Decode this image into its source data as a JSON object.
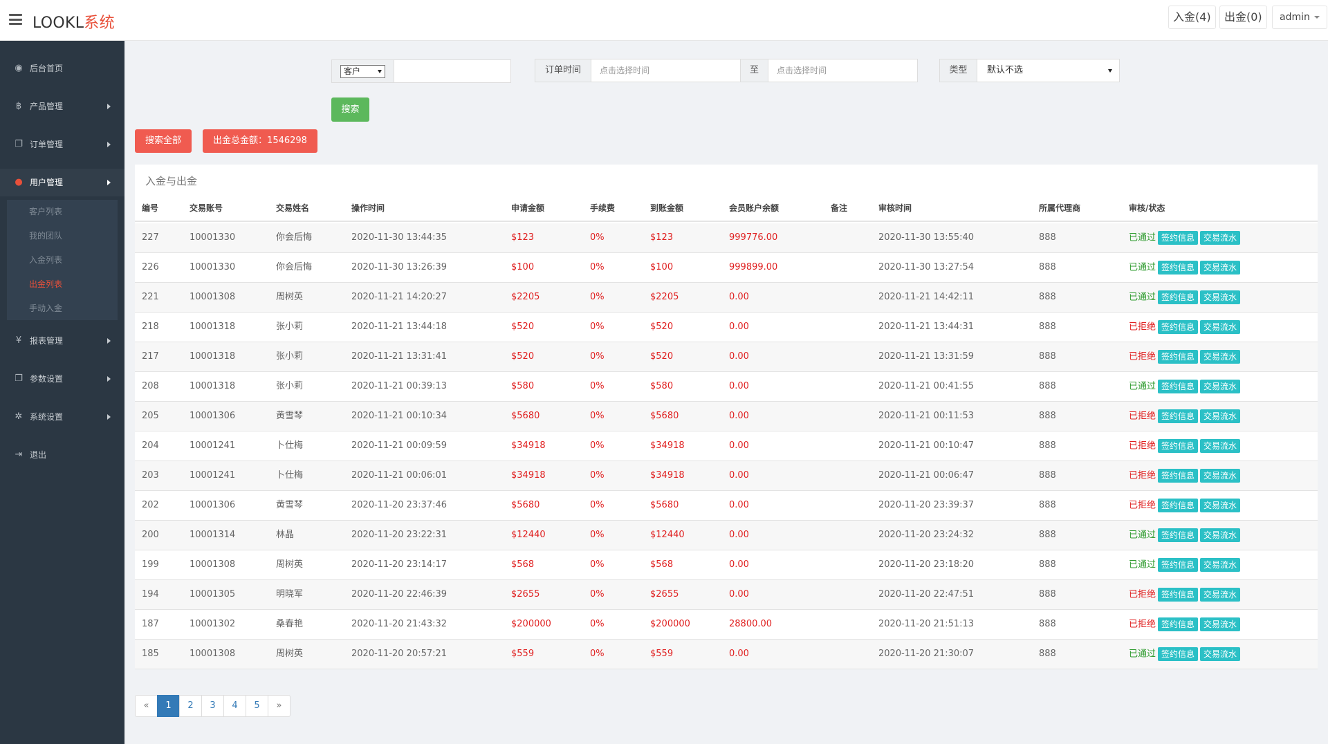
{
  "header": {
    "brand_main": "LOOKL",
    "brand_accent": "系统",
    "deposit_btn": "入金(4)",
    "withdraw_btn": "出金(0)",
    "user_btn": "admin"
  },
  "sidebar": {
    "items": [
      {
        "label": "后台首页",
        "icon": "dashboard-icon",
        "glyph": "◉"
      },
      {
        "label": "产品管理",
        "icon": "bitcoin-icon",
        "glyph": "฿"
      },
      {
        "label": "订单管理",
        "icon": "copy-icon",
        "glyph": "❐"
      },
      {
        "label": "用户管理",
        "icon": "user-icon",
        "glyph": "●"
      },
      {
        "label": "报表管理",
        "icon": "yen-icon",
        "glyph": "¥"
      },
      {
        "label": "参数设置",
        "icon": "copy-icon",
        "glyph": "❐"
      },
      {
        "label": "系统设置",
        "icon": "gears-icon",
        "glyph": "✲"
      },
      {
        "label": "退出",
        "icon": "sign-out-icon",
        "glyph": "⇥"
      }
    ],
    "submenu": [
      "客户列表",
      "我的团队",
      "入金列表",
      "出金列表",
      "手动入金"
    ]
  },
  "search": {
    "customer_select": "客户",
    "customer_input_placeholder": "",
    "order_time_label": "订单时间",
    "start_placeholder": "点击选择时间",
    "to_label": "至",
    "end_placeholder": "点击选择时间",
    "type_label": "类型",
    "type_value": "默认不选",
    "search_btn": "搜索",
    "search_all_btn": "搜索全部",
    "total_btn": "出金总金额：1546298"
  },
  "table": {
    "title": "入金与出金",
    "columns": [
      "编号",
      "交易账号",
      "交易姓名",
      "操作时间",
      "申请金额",
      "手续费",
      "到账金额",
      "会员账户余额",
      "备注",
      "审核时间",
      "所属代理商",
      "审核/状态"
    ],
    "tag_sign": "签约信息",
    "tag_flow": "交易流水",
    "rows": [
      {
        "id": "227",
        "account": "10001330",
        "name": "你会后悔",
        "op_time": "2020-11-30 13:44:35",
        "apply": "$123",
        "fee": "0%",
        "arrive": "$123",
        "balance": "999776.00",
        "remark": "",
        "audit_time": "2020-11-30 13:55:40",
        "agent": "888",
        "status": "已通过",
        "ok": true
      },
      {
        "id": "226",
        "account": "10001330",
        "name": "你会后悔",
        "op_time": "2020-11-30 13:26:39",
        "apply": "$100",
        "fee": "0%",
        "arrive": "$100",
        "balance": "999899.00",
        "remark": "",
        "audit_time": "2020-11-30 13:27:54",
        "agent": "888",
        "status": "已通过",
        "ok": true
      },
      {
        "id": "221",
        "account": "10001308",
        "name": "周树英",
        "op_time": "2020-11-21 14:20:27",
        "apply": "$2205",
        "fee": "0%",
        "arrive": "$2205",
        "balance": "0.00",
        "remark": "",
        "audit_time": "2020-11-21 14:42:11",
        "agent": "888",
        "status": "已通过",
        "ok": true
      },
      {
        "id": "218",
        "account": "10001318",
        "name": "张小莉",
        "op_time": "2020-11-21 13:44:18",
        "apply": "$520",
        "fee": "0%",
        "arrive": "$520",
        "balance": "0.00",
        "remark": "",
        "audit_time": "2020-11-21 13:44:31",
        "agent": "888",
        "status": "已拒绝",
        "ok": false
      },
      {
        "id": "217",
        "account": "10001318",
        "name": "张小莉",
        "op_time": "2020-11-21 13:31:41",
        "apply": "$520",
        "fee": "0%",
        "arrive": "$520",
        "balance": "0.00",
        "remark": "",
        "audit_time": "2020-11-21 13:31:59",
        "agent": "888",
        "status": "已拒绝",
        "ok": false
      },
      {
        "id": "208",
        "account": "10001318",
        "name": "张小莉",
        "op_time": "2020-11-21 00:39:13",
        "apply": "$580",
        "fee": "0%",
        "arrive": "$580",
        "balance": "0.00",
        "remark": "",
        "audit_time": "2020-11-21 00:41:55",
        "agent": "888",
        "status": "已通过",
        "ok": true
      },
      {
        "id": "205",
        "account": "10001306",
        "name": "黄雪琴",
        "op_time": "2020-11-21 00:10:34",
        "apply": "$5680",
        "fee": "0%",
        "arrive": "$5680",
        "balance": "0.00",
        "remark": "",
        "audit_time": "2020-11-21 00:11:53",
        "agent": "888",
        "status": "已拒绝",
        "ok": false
      },
      {
        "id": "204",
        "account": "10001241",
        "name": "卜仕梅",
        "op_time": "2020-11-21 00:09:59",
        "apply": "$34918",
        "fee": "0%",
        "arrive": "$34918",
        "balance": "0.00",
        "remark": "",
        "audit_time": "2020-11-21 00:10:47",
        "agent": "888",
        "status": "已拒绝",
        "ok": false
      },
      {
        "id": "203",
        "account": "10001241",
        "name": "卜仕梅",
        "op_time": "2020-11-21 00:06:01",
        "apply": "$34918",
        "fee": "0%",
        "arrive": "$34918",
        "balance": "0.00",
        "remark": "",
        "audit_time": "2020-11-21 00:06:47",
        "agent": "888",
        "status": "已拒绝",
        "ok": false
      },
      {
        "id": "202",
        "account": "10001306",
        "name": "黄雪琴",
        "op_time": "2020-11-20 23:37:46",
        "apply": "$5680",
        "fee": "0%",
        "arrive": "$5680",
        "balance": "0.00",
        "remark": "",
        "audit_time": "2020-11-20 23:39:37",
        "agent": "888",
        "status": "已拒绝",
        "ok": false
      },
      {
        "id": "200",
        "account": "10001314",
        "name": "林晶",
        "op_time": "2020-11-20 23:22:31",
        "apply": "$12440",
        "fee": "0%",
        "arrive": "$12440",
        "balance": "0.00",
        "remark": "",
        "audit_time": "2020-11-20 23:24:32",
        "agent": "888",
        "status": "已通过",
        "ok": true
      },
      {
        "id": "199",
        "account": "10001308",
        "name": "周树英",
        "op_time": "2020-11-20 23:14:17",
        "apply": "$568",
        "fee": "0%",
        "arrive": "$568",
        "balance": "0.00",
        "remark": "",
        "audit_time": "2020-11-20 23:18:20",
        "agent": "888",
        "status": "已通过",
        "ok": true
      },
      {
        "id": "194",
        "account": "10001305",
        "name": "明晓军",
        "op_time": "2020-11-20 22:46:39",
        "apply": "$2655",
        "fee": "0%",
        "arrive": "$2655",
        "balance": "0.00",
        "remark": "",
        "audit_time": "2020-11-20 22:47:51",
        "agent": "888",
        "status": "已拒绝",
        "ok": false
      },
      {
        "id": "187",
        "account": "10001302",
        "name": "桑春艳",
        "op_time": "2020-11-20 21:43:32",
        "apply": "$200000",
        "fee": "0%",
        "arrive": "$200000",
        "balance": "28800.00",
        "remark": "",
        "audit_time": "2020-11-20 21:51:13",
        "agent": "888",
        "status": "已拒绝",
        "ok": false
      },
      {
        "id": "185",
        "account": "10001308",
        "name": "周树英",
        "op_time": "2020-11-20 20:57:21",
        "apply": "$559",
        "fee": "0%",
        "arrive": "$559",
        "balance": "0.00",
        "remark": "",
        "audit_time": "2020-11-20 21:30:07",
        "agent": "888",
        "status": "已通过",
        "ok": true
      }
    ]
  },
  "pagination": {
    "prev": "«",
    "pages": [
      "1",
      "2",
      "3",
      "4",
      "5"
    ],
    "next": "»",
    "current": "1"
  },
  "colors": {
    "accent_red": "#e8503a",
    "amount_red": "#e02020",
    "approved_green": "#2d9b2d",
    "tag_teal": "#2bc0c6",
    "sidebar_bg": "#2b3743"
  }
}
